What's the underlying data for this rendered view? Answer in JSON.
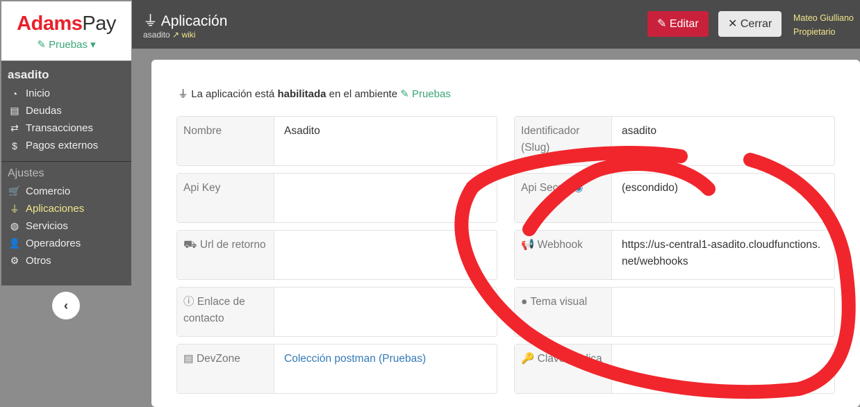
{
  "logo": {
    "part1": "Adams",
    "part2": "Pay",
    "env": "Pruebas"
  },
  "sidebar": {
    "app_name": "asadito",
    "items": [
      {
        "label": "Inicio",
        "icon": "dashboard-icon",
        "glyph": "◔"
      },
      {
        "label": "Deudas",
        "icon": "file-invoice-icon",
        "glyph": "▤"
      },
      {
        "label": "Transacciones",
        "icon": "exchange-icon",
        "glyph": "⇄"
      },
      {
        "label": "Pagos externos",
        "icon": "money-chat-icon",
        "glyph": "$"
      }
    ],
    "section": "Ajustes",
    "settings": [
      {
        "label": "Comercio",
        "icon": "cart-icon",
        "glyph": "🛒"
      },
      {
        "label": "Aplicaciones",
        "icon": "plug-icon",
        "glyph": "⏚"
      },
      {
        "label": "Servicios",
        "icon": "globe-icon",
        "glyph": "◍"
      },
      {
        "label": "Operadores",
        "icon": "user-cog-icon",
        "glyph": "👤"
      },
      {
        "label": "Otros",
        "icon": "gear-icon",
        "glyph": "⚙"
      }
    ],
    "collapse": "‹"
  },
  "header": {
    "title": "Aplicación",
    "slug": "asadito",
    "wiki": "wiki",
    "edit": "Editar",
    "close": "Cerrar",
    "user_name": "Mateo Giulliano",
    "user_role": "Propietario"
  },
  "status": {
    "prefix": "La aplicación está",
    "state": "habilitada",
    "middle": "en el ambiente",
    "env": "Pruebas"
  },
  "fields": {
    "nombre": {
      "label": "Nombre",
      "value": "Asadito"
    },
    "slug": {
      "label": "Identificador (Slug)",
      "value": "asadito"
    },
    "apikey": {
      "label": "Api Key",
      "value": ""
    },
    "apisecret": {
      "label": "Api Secret",
      "value": "(escondido)"
    },
    "url": {
      "label": "Url de retorno",
      "value": ""
    },
    "webhook": {
      "label": "Webhook",
      "value": "https://us-central1-asadito.cloudfunctions.net/webhooks"
    },
    "contacto": {
      "label": "Enlace de contacto",
      "value": ""
    },
    "tema": {
      "label": "Tema visual",
      "value": ""
    },
    "devzone": {
      "label": "DevZone",
      "value": "Colección postman (Pruebas)"
    },
    "clave": {
      "label": "Clave pública",
      "value": ""
    }
  },
  "colors": {
    "brand": "#e8212b",
    "env": "#3aa676",
    "edit": "#c9213b",
    "annotation": "#f0262c"
  }
}
